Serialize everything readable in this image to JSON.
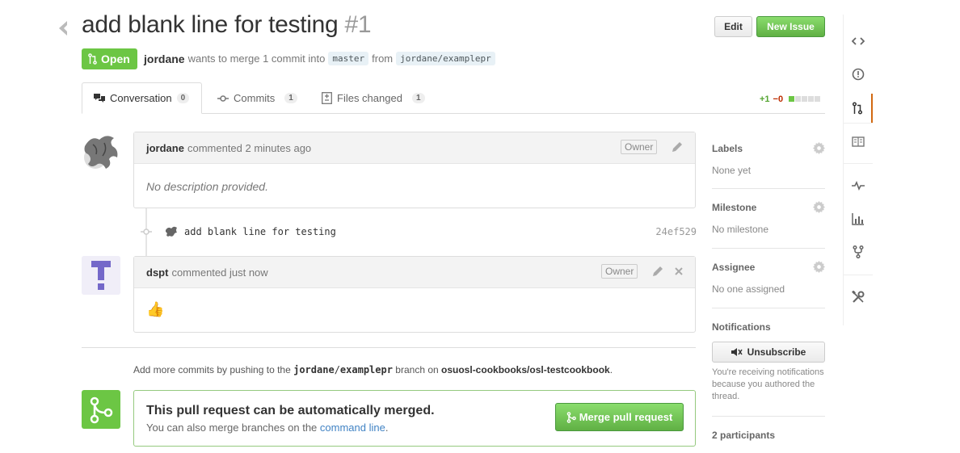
{
  "header": {
    "title": "add blank line for testing",
    "number": "#1",
    "edit_label": "Edit",
    "new_issue_label": "New Issue"
  },
  "meta": {
    "state": "Open",
    "author": "jordane",
    "text_merge": "wants to merge 1 commit into",
    "base_ref": "master",
    "from_text": "from",
    "head_ref": "jordane/examplepr"
  },
  "tabs": [
    {
      "label": "Conversation",
      "count": "0"
    },
    {
      "label": "Commits",
      "count": "1"
    },
    {
      "label": "Files changed",
      "count": "1"
    }
  ],
  "diffstat": {
    "additions": "+1",
    "deletions": "−0"
  },
  "comments": [
    {
      "author": "jordane",
      "action": "commented 2 minutes ago",
      "badge": "Owner",
      "body": "No description provided."
    },
    {
      "author": "dspt",
      "action": "commented just now",
      "badge": "Owner",
      "body": "👍"
    }
  ],
  "commit": {
    "message": "add blank line for testing",
    "sha": "24ef529"
  },
  "push_note": {
    "prefix": "Add more commits by pushing to the",
    "user": "jordane",
    "slash": "/",
    "branch": "examplepr",
    "middle": "branch on",
    "repo": "osuosl-cookbooks/osl-testcookbook",
    "suffix": "."
  },
  "merge": {
    "title": "This pull request can be automatically merged.",
    "sub_prefix": "You can also merge branches on the",
    "sub_link": "command line",
    "sub_suffix": ".",
    "button": "Merge pull request"
  },
  "sidebar": {
    "labels_h": "Labels",
    "labels_v": "None yet",
    "milestone_h": "Milestone",
    "milestone_v": "No milestone",
    "assignee_h": "Assignee",
    "assignee_v": "No one assigned",
    "notifications_h": "Notifications",
    "unsubscribe": "Unsubscribe",
    "notif_note": "You're receiving notifications because you authored the thread.",
    "participants": "2 participants"
  },
  "colors": {
    "open": "#6cc644",
    "accent": "#d26911",
    "link": "#4183c4"
  },
  "icons": [
    "chevron-left-icon",
    "git-pull-request-icon",
    "comment-discussion-icon",
    "git-commit-icon",
    "diff-icon",
    "pencil-icon",
    "close-icon",
    "gear-icon",
    "mute-icon",
    "code-icon",
    "issue-icon",
    "book-icon",
    "pulse-icon",
    "graph-icon",
    "fork-icon",
    "tools-icon"
  ]
}
